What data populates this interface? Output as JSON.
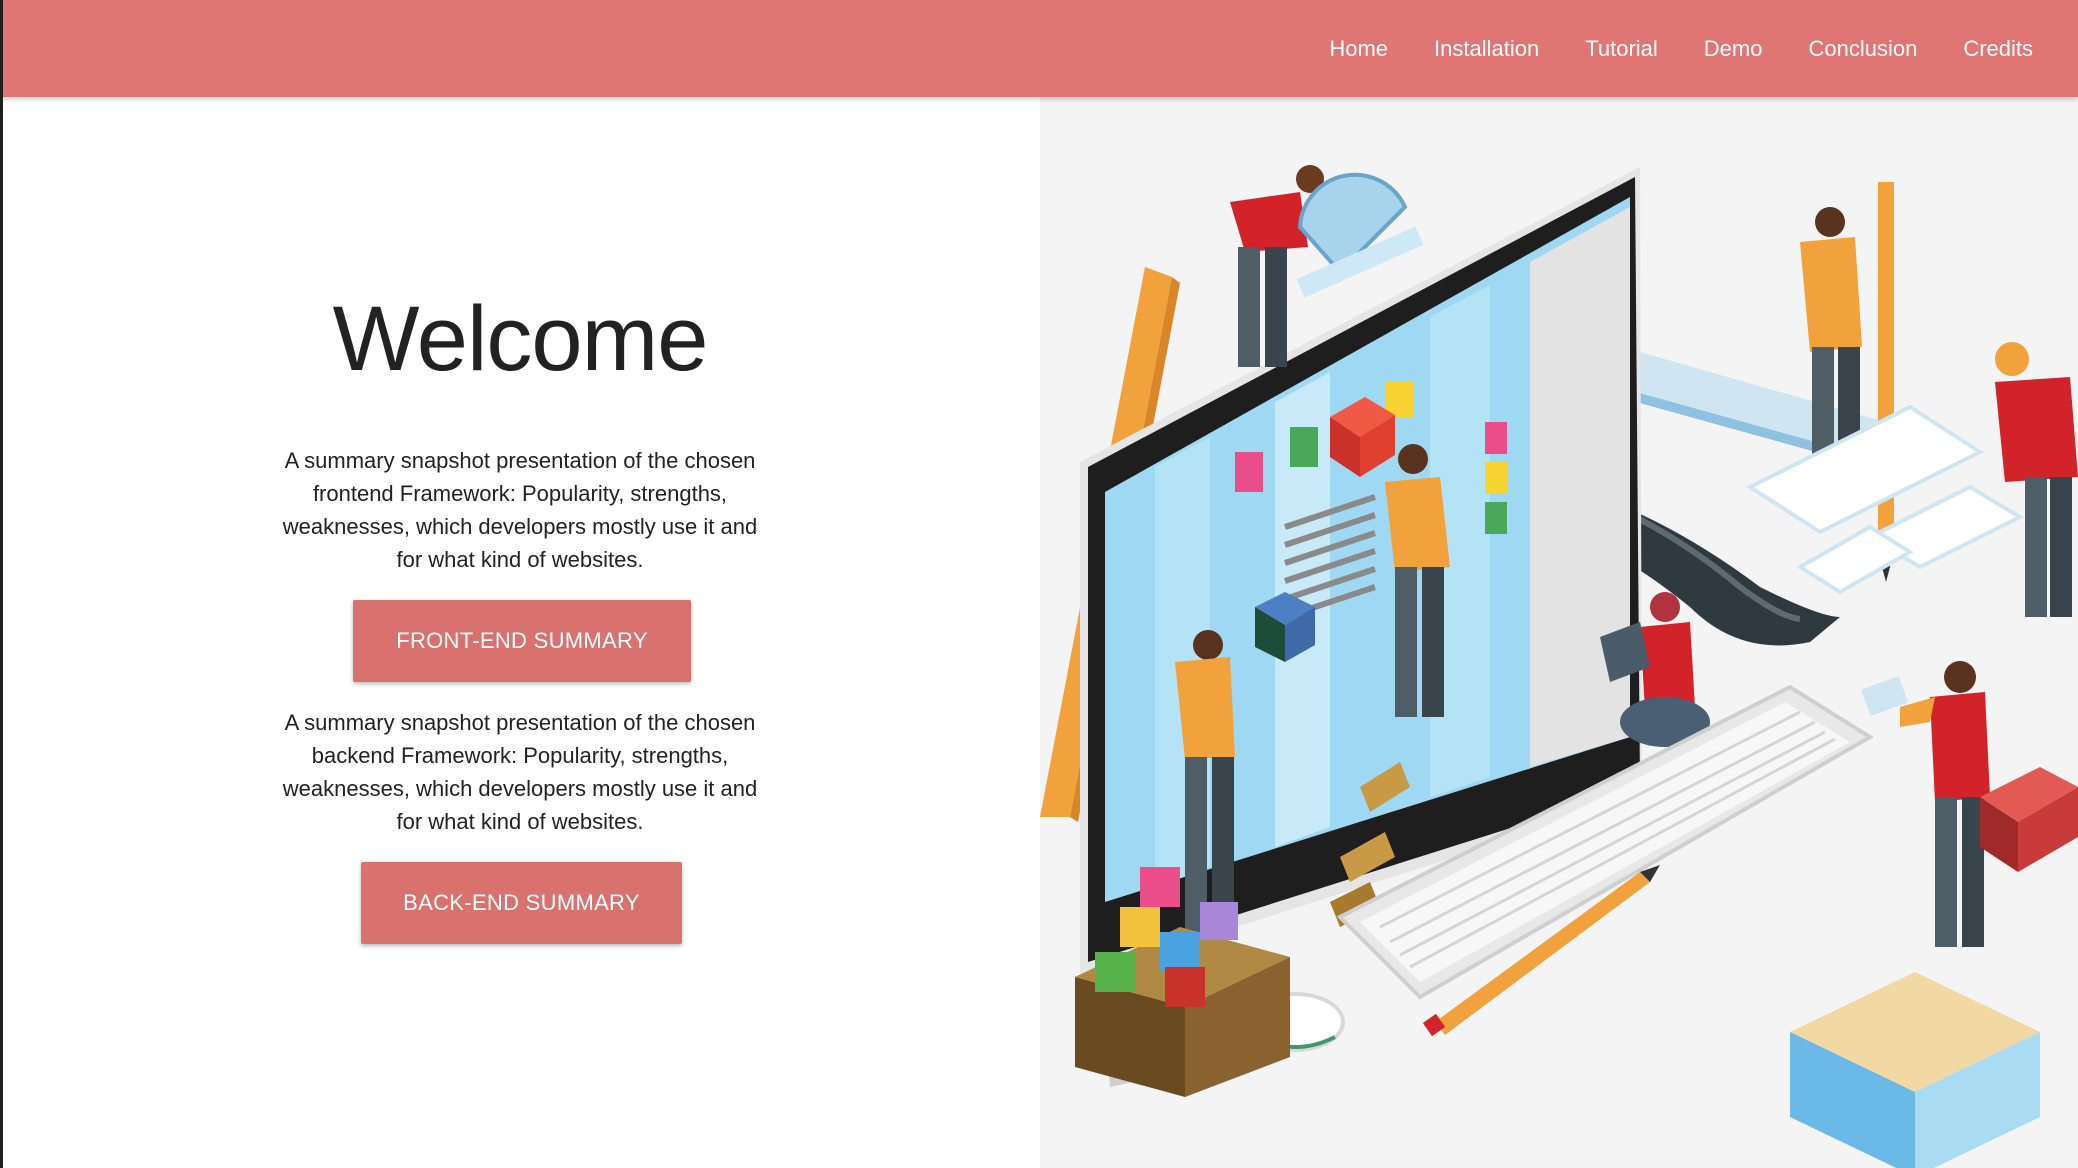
{
  "nav": {
    "items": [
      {
        "label": "Home"
      },
      {
        "label": "Installation"
      },
      {
        "label": "Tutorial"
      },
      {
        "label": "Demo"
      },
      {
        "label": "Conclusion"
      },
      {
        "label": "Credits"
      }
    ]
  },
  "hero": {
    "title": "Welcome",
    "frontend": {
      "text": "A summary snapshot presentation of the chosen frontend Framework: Popularity, strengths, weaknesses, which developers mostly use it and for what kind of websites.",
      "button_label": "FRONT-END SUMMARY"
    },
    "backend": {
      "text": "A summary snapshot presentation of the chosen backend Framework: Popularity, strengths, weaknesses, which developers mostly use it and for what kind of websites.",
      "button_label": "BACK-END SUMMARY"
    },
    "illustration": "isometric-web-development-team-illustration"
  },
  "colors": {
    "navbar": "#df7674",
    "button": "#d9716f",
    "hero_background": "#f4f4f4"
  }
}
